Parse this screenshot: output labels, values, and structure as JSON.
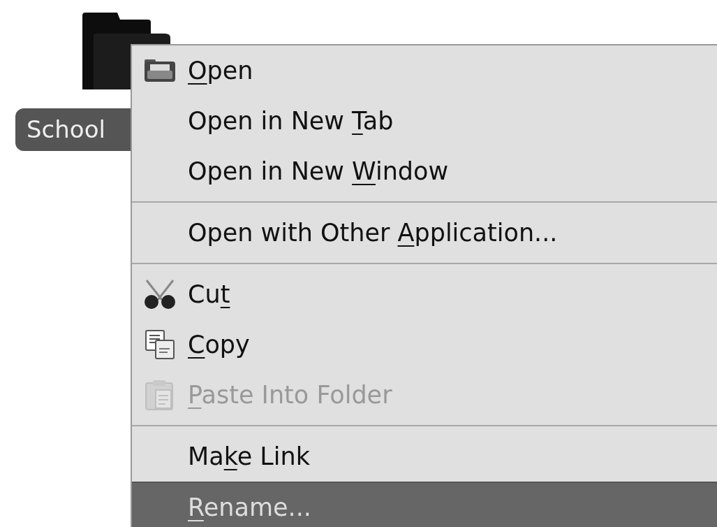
{
  "desktop_icon": {
    "label": "School"
  },
  "context_menu": {
    "items": [
      {
        "kind": "item",
        "key": "O",
        "after": "pen",
        "disabled": false,
        "selected": false
      },
      {
        "kind": "item",
        "before": "Open in New ",
        "key": "T",
        "after": "ab",
        "disabled": false,
        "selected": false
      },
      {
        "kind": "item",
        "before": "Open in New ",
        "key": "W",
        "after": "indow",
        "disabled": false,
        "selected": false
      },
      {
        "kind": "separator"
      },
      {
        "kind": "item",
        "before": "Open with Other ",
        "key": "A",
        "after": "pplication...",
        "disabled": false,
        "selected": false
      },
      {
        "kind": "separator"
      },
      {
        "kind": "item",
        "before": "Cu",
        "key": "t",
        "disabled": false,
        "selected": false
      },
      {
        "kind": "item",
        "key": "C",
        "after": "opy",
        "disabled": false,
        "selected": false
      },
      {
        "kind": "item",
        "key": "P",
        "after": "aste Into Folder",
        "disabled": true,
        "selected": false
      },
      {
        "kind": "separator"
      },
      {
        "kind": "item",
        "before": "Ma",
        "key": "k",
        "after": "e Link",
        "disabled": false,
        "selected": false
      },
      {
        "kind": "item",
        "key": "R",
        "after": "ename...",
        "disabled": false,
        "selected": true
      }
    ]
  }
}
